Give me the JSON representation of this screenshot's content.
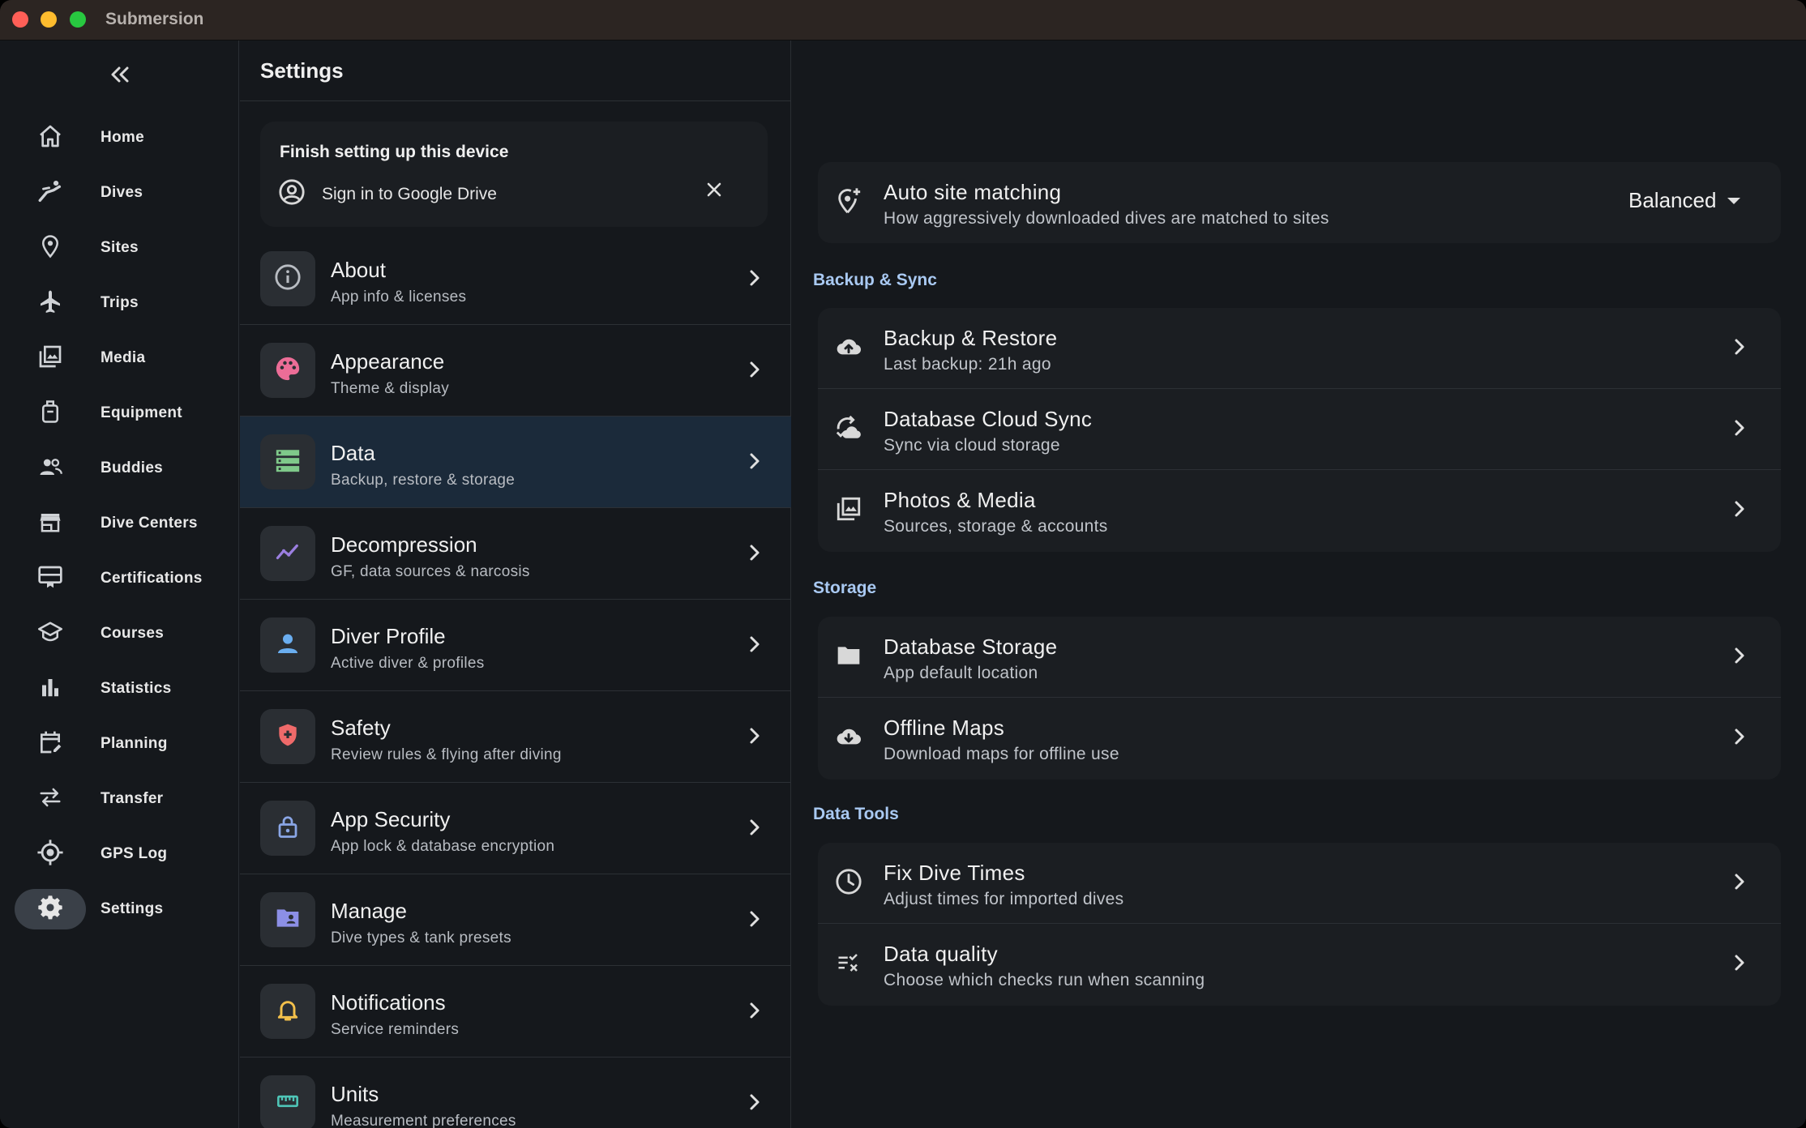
{
  "window": {
    "title": "Submersion"
  },
  "sidebar": {
    "items": [
      {
        "label": "Home",
        "icon": "home-icon"
      },
      {
        "label": "Dives",
        "icon": "diver-icon"
      },
      {
        "label": "Sites",
        "icon": "location-pin-icon"
      },
      {
        "label": "Trips",
        "icon": "airplane-icon"
      },
      {
        "label": "Media",
        "icon": "photo-library-icon"
      },
      {
        "label": "Equipment",
        "icon": "tank-icon"
      },
      {
        "label": "Buddies",
        "icon": "people-icon"
      },
      {
        "label": "Dive Centers",
        "icon": "storefront-icon"
      },
      {
        "label": "Certifications",
        "icon": "card-icon"
      },
      {
        "label": "Courses",
        "icon": "graduation-cap-icon"
      },
      {
        "label": "Statistics",
        "icon": "bar-chart-icon"
      },
      {
        "label": "Planning",
        "icon": "calendar-edit-icon"
      },
      {
        "label": "Transfer",
        "icon": "swap-arrows-icon"
      },
      {
        "label": "GPS Log",
        "icon": "gps-icon"
      },
      {
        "label": "Settings",
        "icon": "gear-icon"
      }
    ],
    "active": "Settings"
  },
  "settings": {
    "title": "Settings",
    "setup_card": {
      "title": "Finish setting up this device",
      "action": "Sign in to Google Drive"
    },
    "categories": [
      {
        "title": "About",
        "subtitle": "App info & licenses",
        "icon": "info-icon",
        "color": "#b8bcc2"
      },
      {
        "title": "Appearance",
        "subtitle": "Theme & display",
        "icon": "palette-icon",
        "color": "#ec6d97"
      },
      {
        "title": "Data",
        "subtitle": "Backup, restore & storage",
        "icon": "storage-icon",
        "color": "#7fc98a"
      },
      {
        "title": "Decompression",
        "subtitle": "GF, data sources & narcosis",
        "icon": "trend-line-icon",
        "color": "#9b7fe0"
      },
      {
        "title": "Diver Profile",
        "subtitle": "Active diver & profiles",
        "icon": "person-icon",
        "color": "#6aaef0"
      },
      {
        "title": "Safety",
        "subtitle": "Review rules & flying after diving",
        "icon": "shield-icon",
        "color": "#ef6a6a"
      },
      {
        "title": "App Security",
        "subtitle": "App lock & database encryption",
        "icon": "lock-icon",
        "color": "#8aa6e6"
      },
      {
        "title": "Manage",
        "subtitle": "Dive types & tank presets",
        "icon": "folder-person-icon",
        "color": "#8c8fe6"
      },
      {
        "title": "Notifications",
        "subtitle": "Service reminders",
        "icon": "bell-icon",
        "color": "#f3c04b"
      },
      {
        "title": "Units",
        "subtitle": "Measurement preferences",
        "icon": "ruler-icon",
        "color": "#4fc6b8"
      }
    ],
    "active_category": "Data"
  },
  "detail": {
    "auto_site": {
      "title": "Auto site matching",
      "subtitle": "How aggressively downloaded dives are matched to sites",
      "value": "Balanced"
    },
    "sections": [
      {
        "label": "Backup & Sync",
        "rows": [
          {
            "title": "Backup & Restore",
            "subtitle": "Last backup: 21h ago",
            "icon": "cloud-upload-icon"
          },
          {
            "title": "Database Cloud Sync",
            "subtitle": "Sync via cloud storage",
            "icon": "cloud-sync-icon"
          },
          {
            "title": "Photos & Media",
            "subtitle": "Sources, storage & accounts",
            "icon": "photo-library-icon"
          }
        ]
      },
      {
        "label": "Storage",
        "rows": [
          {
            "title": "Database Storage",
            "subtitle": "App default location",
            "icon": "folder-icon"
          },
          {
            "title": "Offline Maps",
            "subtitle": "Download maps for offline use",
            "icon": "cloud-download-icon"
          }
        ]
      },
      {
        "label": "Data Tools",
        "rows": [
          {
            "title": "Fix Dive Times",
            "subtitle": "Adjust times for imported dives",
            "icon": "clock-icon"
          },
          {
            "title": "Data quality",
            "subtitle": "Choose which checks run when scanning",
            "icon": "checklist-icon"
          }
        ]
      }
    ]
  }
}
